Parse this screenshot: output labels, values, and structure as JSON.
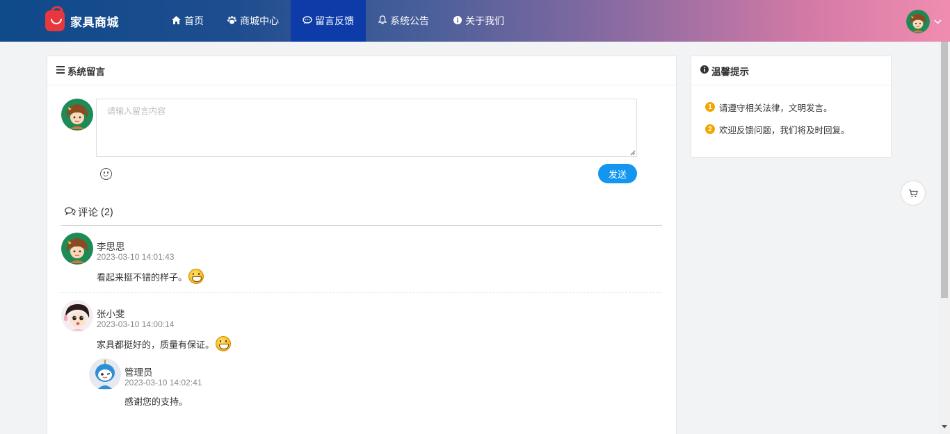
{
  "brand": {
    "name": "家具商城"
  },
  "nav": {
    "items": [
      {
        "label": "首页",
        "icon": "home-icon"
      },
      {
        "label": "商城中心",
        "icon": "paw-icon"
      },
      {
        "label": "留言反馈",
        "icon": "chat-icon",
        "active": true
      },
      {
        "label": "系统公告",
        "icon": "bell-icon"
      },
      {
        "label": "关于我们",
        "icon": "info-icon"
      }
    ]
  },
  "main": {
    "title": "系统留言",
    "composer": {
      "placeholder": "请输入留言内容",
      "send_label": "发送"
    },
    "comments_title": "评论",
    "comments_count": "(2)",
    "comments": [
      {
        "name": "李思思",
        "time": "2023-03-10 14:01:43",
        "text": "看起来挺不错的样子。"
      },
      {
        "name": "张小斐",
        "time": "2023-03-10 14:00:14",
        "text": "家具都挺好的，质量有保证。"
      }
    ],
    "reply": {
      "name": "管理员",
      "time": "2023-03-10 14:02:41",
      "text": "感谢您的支持。"
    }
  },
  "side": {
    "title": "温馨提示",
    "tips": [
      {
        "num": "1",
        "text": "请遵守相关法律，文明发言。"
      },
      {
        "num": "2",
        "text": "欢迎反馈问题，我们将及时回复。"
      }
    ]
  },
  "colors": {
    "accent": "#1296f0",
    "nav_active": "#0d3ca8",
    "tip_badge": "#f5a500"
  }
}
